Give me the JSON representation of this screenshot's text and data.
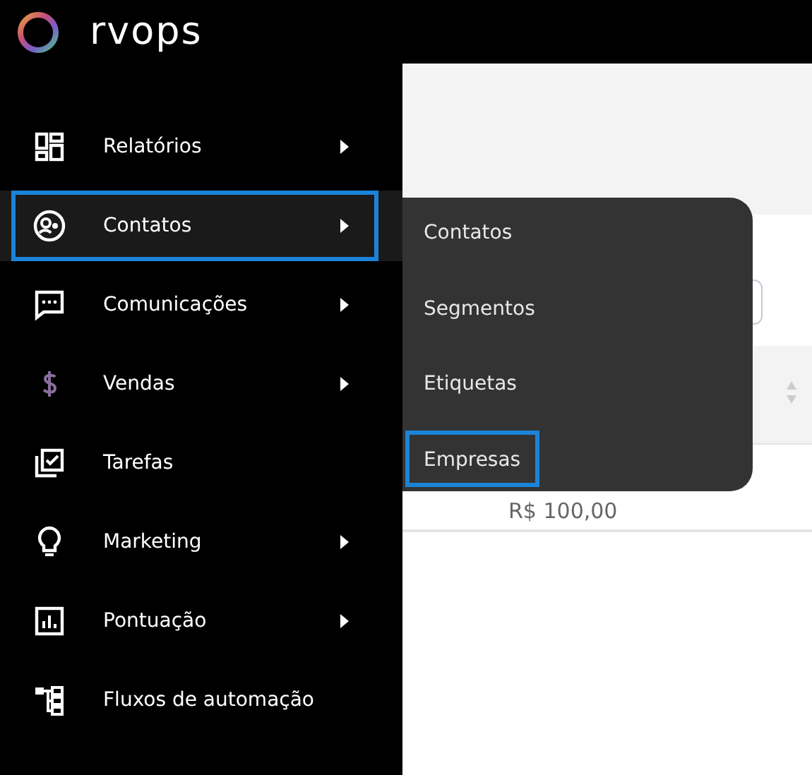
{
  "brand": {
    "name": "rvops"
  },
  "sidebar": {
    "items": [
      {
        "label": "Relatórios",
        "has_submenu": true,
        "selected": false
      },
      {
        "label": "Contatos",
        "has_submenu": true,
        "selected": true
      },
      {
        "label": "Comunicações",
        "has_submenu": true,
        "selected": false
      },
      {
        "label": "Vendas",
        "has_submenu": true,
        "selected": false
      },
      {
        "label": "Tarefas",
        "has_submenu": false,
        "selected": false
      },
      {
        "label": "Marketing",
        "has_submenu": true,
        "selected": false
      },
      {
        "label": "Pontuação",
        "has_submenu": true,
        "selected": false
      },
      {
        "label": "Fluxos de automação",
        "has_submenu": false,
        "selected": false
      }
    ]
  },
  "submenu": {
    "items": [
      {
        "label": "Contatos",
        "selected": false
      },
      {
        "label": "Segmentos",
        "selected": false
      },
      {
        "label": "Etiquetas",
        "selected": false
      },
      {
        "label": "Empresas",
        "selected": true
      }
    ]
  },
  "table": {
    "rows": [
      {
        "value": "R$ 100,00"
      }
    ]
  }
}
